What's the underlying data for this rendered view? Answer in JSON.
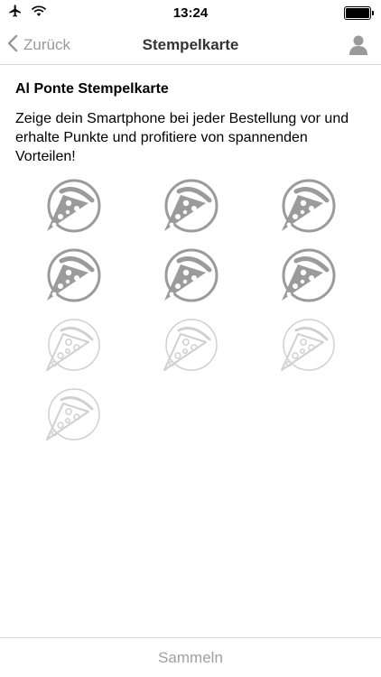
{
  "status_bar": {
    "time": "13:24"
  },
  "nav": {
    "back_label": "Zurück",
    "title": "Stempelkarte"
  },
  "card": {
    "title": "Al Ponte Stempelkarte",
    "description": "Zeige dein Smartphone bei jeder Bestellung vor und erhalte Punkte und profitiere von spannenden Vorteilen!"
  },
  "stamps": [
    {
      "collected": true
    },
    {
      "collected": true
    },
    {
      "collected": true
    },
    {
      "collected": true
    },
    {
      "collected": true
    },
    {
      "collected": true
    },
    {
      "collected": false
    },
    {
      "collected": false
    },
    {
      "collected": false
    },
    {
      "collected": false
    }
  ],
  "bottom": {
    "collect_label": "Sammeln"
  },
  "colors": {
    "stamp_collected": "#9b9b9b",
    "stamp_empty": "#d0d0d0",
    "muted_text": "#9a9a9a"
  }
}
